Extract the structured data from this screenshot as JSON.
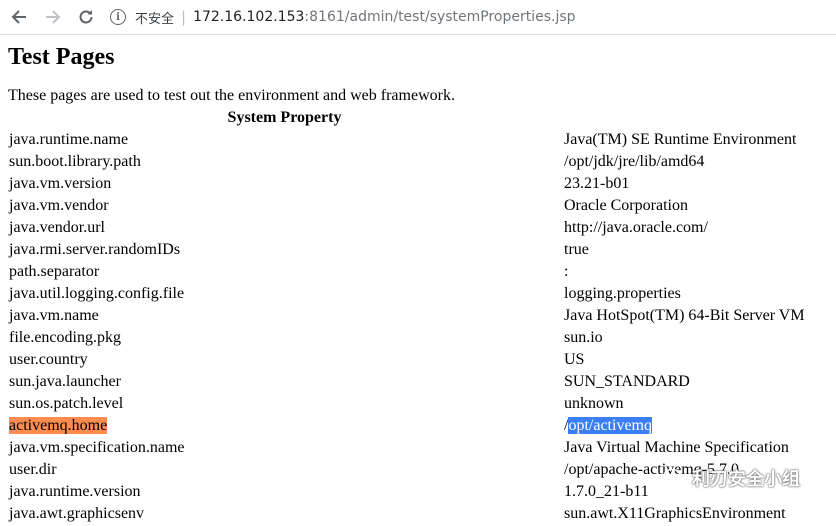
{
  "browser": {
    "insecure_label": "不安全",
    "url_host": "172.16.102.153",
    "url_rest": ":8161/admin/test/systemProperties.jsp"
  },
  "page": {
    "title": "Test Pages",
    "intro": "These pages are used to test out the environment and web framework.",
    "table_header": "System Property",
    "rows": [
      {
        "key": "java.runtime.name",
        "value": "Java(TM) SE Runtime Environment"
      },
      {
        "key": "sun.boot.library.path",
        "value": "/opt/jdk/jre/lib/amd64"
      },
      {
        "key": "java.vm.version",
        "value": "23.21-b01"
      },
      {
        "key": "java.vm.vendor",
        "value": "Oracle Corporation"
      },
      {
        "key": "java.vendor.url",
        "value": "http://java.oracle.com/"
      },
      {
        "key": "java.rmi.server.randomIDs",
        "value": "true"
      },
      {
        "key": "path.separator",
        "value": ":"
      },
      {
        "key": "java.util.logging.config.file",
        "value": "logging.properties"
      },
      {
        "key": "java.vm.name",
        "value": "Java HotSpot(TM) 64-Bit Server VM"
      },
      {
        "key": "file.encoding.pkg",
        "value": "sun.io"
      },
      {
        "key": "user.country",
        "value": "US"
      },
      {
        "key": "sun.java.launcher",
        "value": "SUN_STANDARD"
      },
      {
        "key": "sun.os.patch.level",
        "value": "unknown"
      },
      {
        "key": "activemq.home",
        "value_prefix": "/",
        "value": "opt/activemq"
      },
      {
        "key": "java.vm.specification.name",
        "value": "Java Virtual Machine Specification"
      },
      {
        "key": "user.dir",
        "value": "/opt/apache-activemq-5.7.0"
      },
      {
        "key": "java.runtime.version",
        "value": "1.7.0_21-b11"
      },
      {
        "key": "java.awt.graphicsenv",
        "value": "sun.awt.X11GraphicsEnvironment"
      }
    ]
  },
  "highlight_colors": {
    "key_highlight": "#fe8c4e",
    "selection": "#3b7ff6"
  },
  "watermark": {
    "text": "利刃安全小组",
    "icon": "wechat-icon"
  }
}
